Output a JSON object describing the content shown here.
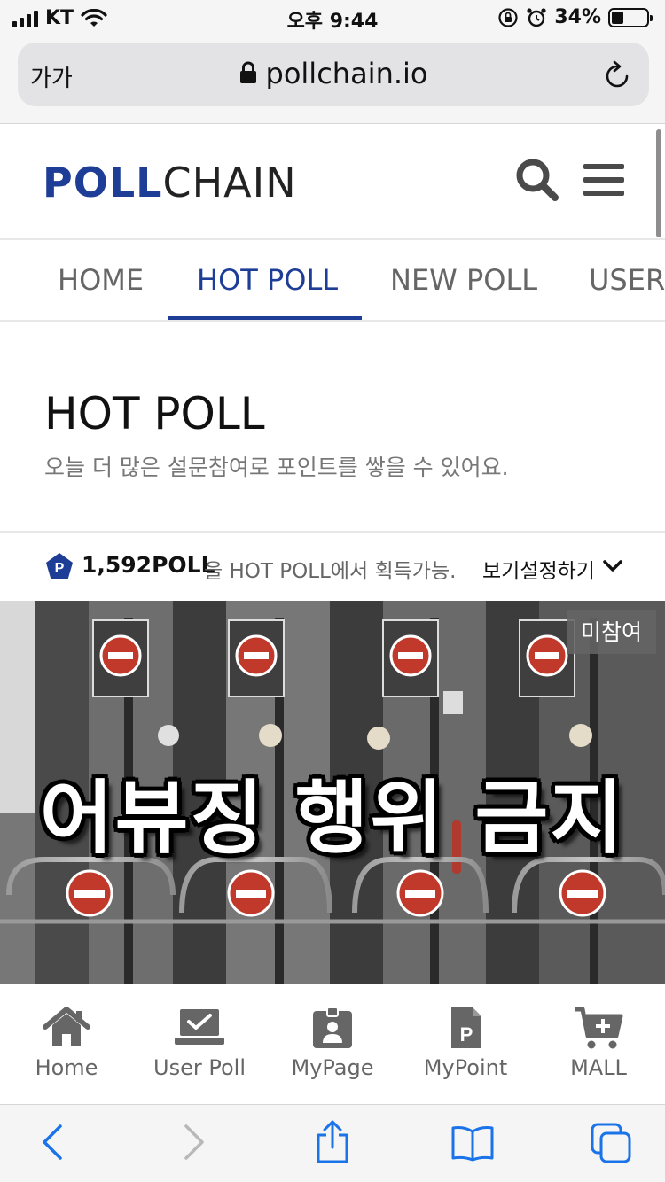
{
  "status_bar": {
    "carrier": "KT",
    "time": "오후 9:44",
    "battery_percent": "34%",
    "battery_level": 0.34
  },
  "browser": {
    "text_size_label": "가가",
    "url": "pollchain.io"
  },
  "header": {
    "logo_bold": "POLL",
    "logo_regular": "CHAIN"
  },
  "tabs": [
    {
      "label": "HOME",
      "active": false
    },
    {
      "label": "HOT POLL",
      "active": true
    },
    {
      "label": "NEW POLL",
      "active": false
    },
    {
      "label": "USER",
      "active": false
    }
  ],
  "page": {
    "title": "HOT POLL",
    "subtitle": "오늘 더 많은 설문참여로 포인트를 쌓을 수 있어요."
  },
  "points": {
    "badge_letter": "P",
    "amount": "1,592POLL",
    "description": "을 HOT POLL에서 획득가능.",
    "view_settings": "보기설정하기"
  },
  "poll_card": {
    "status_badge": "미참여",
    "banner_text": "어뷰징 행위 금지"
  },
  "bottom_nav": [
    {
      "label": "Home",
      "icon": "home-icon"
    },
    {
      "label": "User Poll",
      "icon": "user-poll-icon"
    },
    {
      "label": "MyPage",
      "icon": "id-badge-icon"
    },
    {
      "label": "MyPoint",
      "icon": "point-file-icon"
    },
    {
      "label": "MALL",
      "icon": "cart-plus-icon"
    }
  ],
  "colors": {
    "brand_blue": "#1e3d96",
    "icon_gray": "#666666",
    "safari_blue": "#1a73e8"
  }
}
